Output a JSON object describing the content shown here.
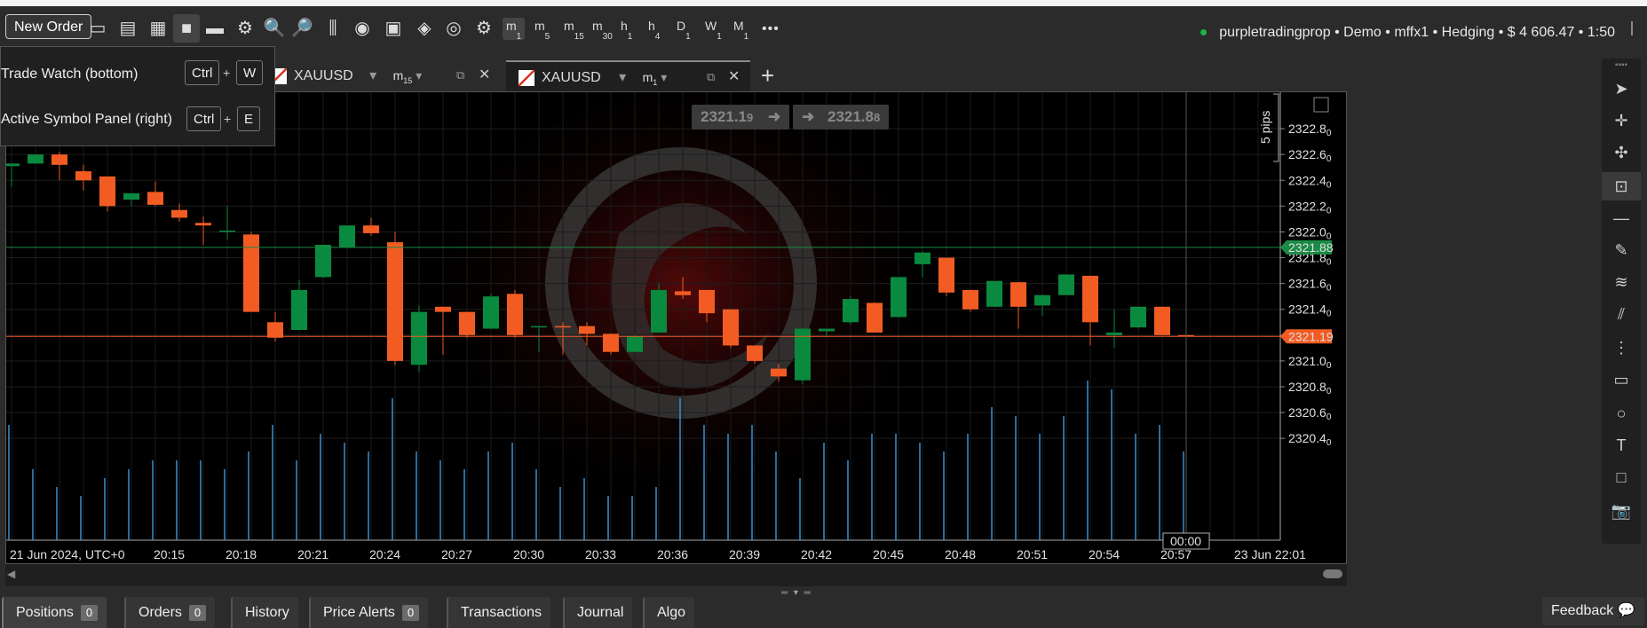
{
  "toolbar": {
    "new_order_label": "New Order",
    "timeframes": [
      {
        "main": "m",
        "sub": "1",
        "active": true
      },
      {
        "main": "m",
        "sub": "5"
      },
      {
        "main": "m",
        "sub": "15"
      },
      {
        "main": "m",
        "sub": "30"
      },
      {
        "main": "h",
        "sub": "1"
      },
      {
        "main": "h",
        "sub": "4"
      },
      {
        "main": "D",
        "sub": "1"
      },
      {
        "main": "W",
        "sub": "1"
      },
      {
        "main": "M",
        "sub": "1"
      }
    ],
    "more_label": "•••",
    "account_info": "purpletradingprop • Demo • mffx1 • Hedging • $ 4 606.47 • 1:50"
  },
  "popup_menu": {
    "items": [
      {
        "label": "Trade Watch (bottom)",
        "key1": "Ctrl",
        "plus": "+",
        "key2": "W"
      },
      {
        "label": "Active Symbol Panel (right)",
        "key1": "Ctrl",
        "plus": "+",
        "key2": "E"
      }
    ]
  },
  "tabs": [
    {
      "symbol": "XAUUSD",
      "tf_main": "m",
      "tf_sub": "15",
      "active": false
    },
    {
      "symbol": "XAUUSD",
      "tf_main": "m",
      "tf_sub": "1",
      "active": true
    }
  ],
  "quote": {
    "bid_main": "2321.1",
    "bid_small": "9",
    "ask_main": "2321.8",
    "ask_small": "8"
  },
  "pips_label": "5 pips",
  "crosshair_time": "00:00",
  "colors": {
    "bull": "#0a8a3e",
    "bear": "#f25c22",
    "volume": "#3a8fd0",
    "ask_line": "#1a8a45",
    "bid_line": "#f25c22"
  },
  "chart_data": {
    "type": "candlestick",
    "symbol": "XAUUSD",
    "timeframe": "m1",
    "ylim": [
      2320.25,
      2323.0
    ],
    "y_ticks": [
      {
        "major": "2322.8",
        "minor": "0"
      },
      {
        "major": "2322.6",
        "minor": "0"
      },
      {
        "major": "2322.4",
        "minor": "0"
      },
      {
        "major": "2322.2",
        "minor": "0"
      },
      {
        "major": "2322.0",
        "minor": "0"
      },
      {
        "major": "2321.8",
        "minor": "0"
      },
      {
        "major": "2321.6",
        "minor": "0"
      },
      {
        "major": "2321.4",
        "minor": "0"
      },
      {
        "major": "2321.2",
        "minor": "0"
      },
      {
        "major": "2321.0",
        "minor": "0"
      },
      {
        "major": "2320.8",
        "minor": "0"
      },
      {
        "major": "2320.6",
        "minor": "0"
      },
      {
        "major": "2320.4",
        "minor": "0"
      }
    ],
    "x_labels": [
      "21 Jun 2024, UTC+0",
      "20:15",
      "20:18",
      "20:21",
      "20:24",
      "20:27",
      "20:30",
      "20:33",
      "20:36",
      "20:39",
      "20:42",
      "20:45",
      "20:48",
      "20:51",
      "20:54",
      "20:57",
      "23 Jun 22:01"
    ],
    "ask_price": 2321.88,
    "ask_label": "2321.88",
    "bid_price": 2321.19,
    "bid_label": "2321.19",
    "candles": [
      {
        "o": 2322.51,
        "h": 2322.53,
        "l": 2322.35,
        "c": 2322.53
      },
      {
        "o": 2322.53,
        "h": 2322.6,
        "l": 2322.53,
        "c": 2322.6
      },
      {
        "o": 2322.6,
        "h": 2322.62,
        "l": 2322.4,
        "c": 2322.52
      },
      {
        "o": 2322.47,
        "h": 2322.52,
        "l": 2322.32,
        "c": 2322.4
      },
      {
        "o": 2322.43,
        "h": 2322.43,
        "l": 2322.16,
        "c": 2322.2
      },
      {
        "o": 2322.25,
        "h": 2322.3,
        "l": 2322.2,
        "c": 2322.3
      },
      {
        "o": 2322.31,
        "h": 2322.39,
        "l": 2322.2,
        "c": 2322.21
      },
      {
        "o": 2322.17,
        "h": 2322.22,
        "l": 2322.08,
        "c": 2322.11
      },
      {
        "o": 2322.07,
        "h": 2322.12,
        "l": 2321.9,
        "c": 2322.05
      },
      {
        "o": 2322.01,
        "h": 2322.2,
        "l": 2321.94,
        "c": 2322.01
      },
      {
        "o": 2321.98,
        "h": 2322.0,
        "l": 2321.4,
        "c": 2321.38
      },
      {
        "o": 2321.3,
        "h": 2321.38,
        "l": 2321.15,
        "c": 2321.18
      },
      {
        "o": 2321.24,
        "h": 2321.63,
        "l": 2321.24,
        "c": 2321.55
      },
      {
        "o": 2321.65,
        "h": 2321.9,
        "l": 2321.64,
        "c": 2321.9
      },
      {
        "o": 2321.88,
        "h": 2322.05,
        "l": 2321.87,
        "c": 2322.05
      },
      {
        "o": 2322.05,
        "h": 2322.11,
        "l": 2321.97,
        "c": 2321.99
      },
      {
        "o": 2321.92,
        "h": 2322.0,
        "l": 2320.97,
        "c": 2321.0
      },
      {
        "o": 2320.97,
        "h": 2321.43,
        "l": 2320.91,
        "c": 2321.38
      },
      {
        "o": 2321.42,
        "h": 2321.42,
        "l": 2321.05,
        "c": 2321.38
      },
      {
        "o": 2321.38,
        "h": 2321.38,
        "l": 2321.18,
        "c": 2321.2
      },
      {
        "o": 2321.25,
        "h": 2321.52,
        "l": 2321.25,
        "c": 2321.5
      },
      {
        "o": 2321.52,
        "h": 2321.55,
        "l": 2321.18,
        "c": 2321.2
      },
      {
        "o": 2321.27,
        "h": 2321.27,
        "l": 2321.07,
        "c": 2321.27
      },
      {
        "o": 2321.27,
        "h": 2321.3,
        "l": 2321.05,
        "c": 2321.26
      },
      {
        "o": 2321.27,
        "h": 2321.3,
        "l": 2321.12,
        "c": 2321.21
      },
      {
        "o": 2321.21,
        "h": 2321.21,
        "l": 2321.05,
        "c": 2321.07
      },
      {
        "o": 2321.07,
        "h": 2321.2,
        "l": 2321.07,
        "c": 2321.19
      },
      {
        "o": 2321.22,
        "h": 2321.6,
        "l": 2321.22,
        "c": 2321.55
      },
      {
        "o": 2321.54,
        "h": 2321.65,
        "l": 2321.48,
        "c": 2321.51
      },
      {
        "o": 2321.55,
        "h": 2321.55,
        "l": 2321.3,
        "c": 2321.37
      },
      {
        "o": 2321.4,
        "h": 2321.4,
        "l": 2321.1,
        "c": 2321.12
      },
      {
        "o": 2321.12,
        "h": 2321.12,
        "l": 2320.98,
        "c": 2321.0
      },
      {
        "o": 2320.94,
        "h": 2320.98,
        "l": 2320.84,
        "c": 2320.88
      },
      {
        "o": 2320.85,
        "h": 2321.25,
        "l": 2320.82,
        "c": 2321.25
      },
      {
        "o": 2321.23,
        "h": 2321.25,
        "l": 2321.19,
        "c": 2321.25
      },
      {
        "o": 2321.3,
        "h": 2321.5,
        "l": 2321.28,
        "c": 2321.48
      },
      {
        "o": 2321.45,
        "h": 2321.45,
        "l": 2321.22,
        "c": 2321.22
      },
      {
        "o": 2321.34,
        "h": 2321.65,
        "l": 2321.34,
        "c": 2321.65
      },
      {
        "o": 2321.75,
        "h": 2321.85,
        "l": 2321.65,
        "c": 2321.84
      },
      {
        "o": 2321.8,
        "h": 2321.8,
        "l": 2321.5,
        "c": 2321.53
      },
      {
        "o": 2321.55,
        "h": 2321.55,
        "l": 2321.38,
        "c": 2321.4
      },
      {
        "o": 2321.42,
        "h": 2321.62,
        "l": 2321.42,
        "c": 2321.62
      },
      {
        "o": 2321.61,
        "h": 2321.61,
        "l": 2321.25,
        "c": 2321.42
      },
      {
        "o": 2321.43,
        "h": 2321.51,
        "l": 2321.35,
        "c": 2321.51
      },
      {
        "o": 2321.51,
        "h": 2321.67,
        "l": 2321.51,
        "c": 2321.67
      },
      {
        "o": 2321.66,
        "h": 2321.66,
        "l": 2321.12,
        "c": 2321.3
      },
      {
        "o": 2321.2,
        "h": 2321.4,
        "l": 2321.1,
        "c": 2321.22
      },
      {
        "o": 2321.26,
        "h": 2321.42,
        "l": 2321.25,
        "c": 2321.42
      },
      {
        "o": 2321.42,
        "h": 2321.42,
        "l": 2321.2,
        "c": 2321.2
      },
      {
        "o": 2321.2,
        "h": 2321.21,
        "l": 2321.19,
        "c": 2321.19
      }
    ],
    "volumes": [
      13,
      8,
      6,
      5,
      7,
      8,
      9,
      9,
      9,
      8,
      10,
      13,
      9,
      12,
      11,
      10,
      16,
      10,
      9,
      8,
      10,
      11,
      8,
      6,
      7,
      5,
      5,
      6,
      16,
      13,
      12,
      13,
      10,
      7,
      11,
      9,
      12,
      12,
      11,
      10,
      12,
      15,
      14,
      12,
      14,
      18,
      17,
      12,
      13,
      10
    ]
  }
}
